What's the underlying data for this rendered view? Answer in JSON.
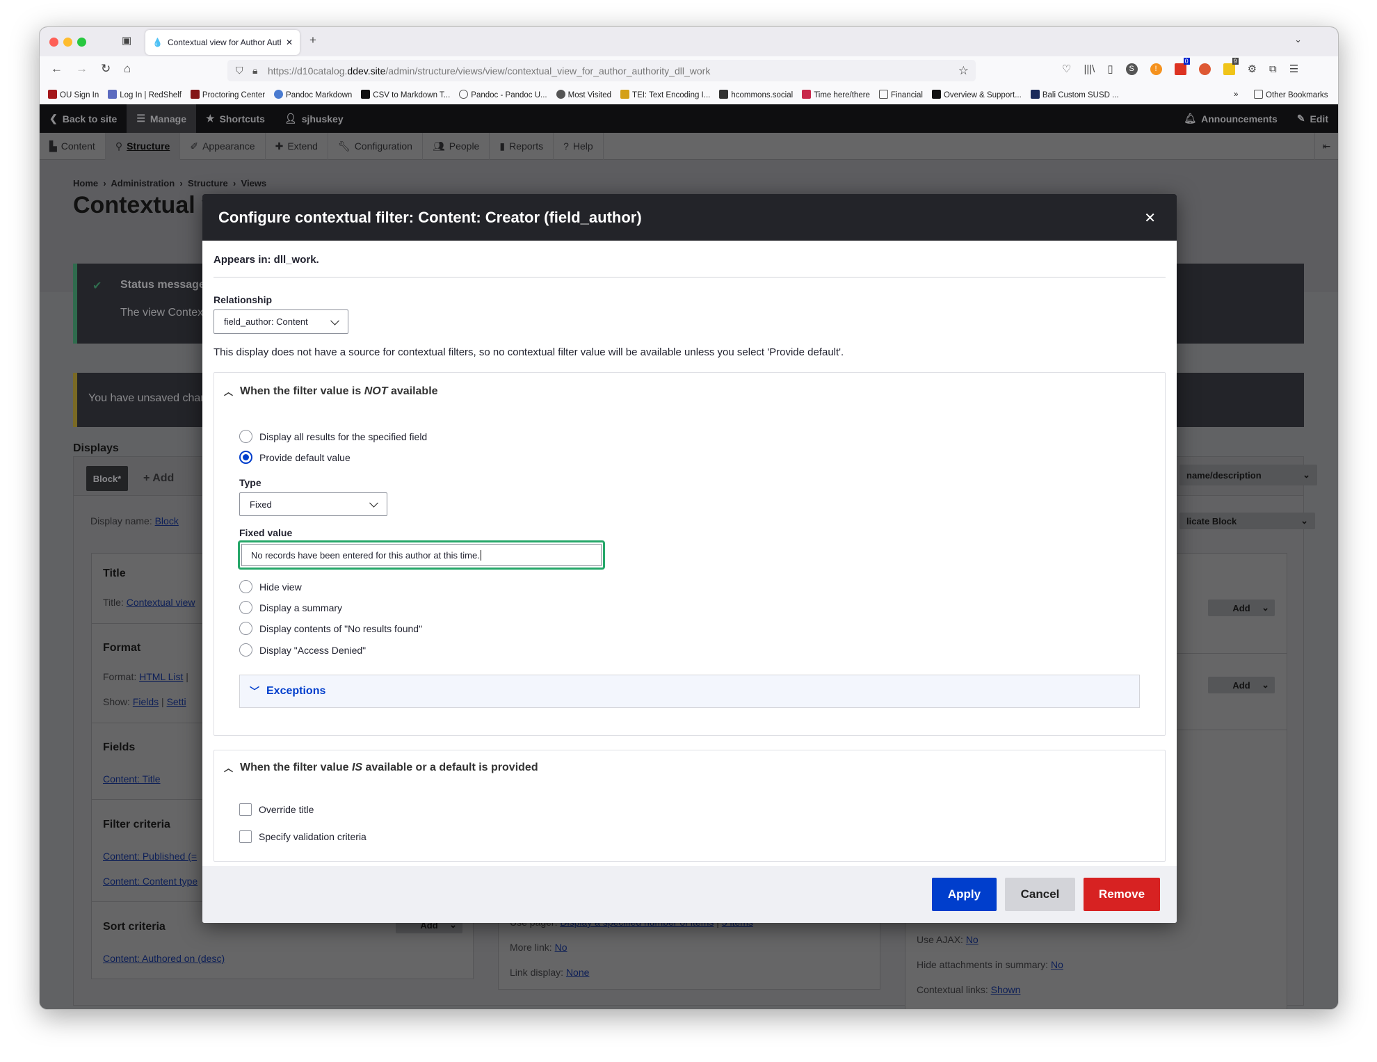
{
  "browser": {
    "tab_title": "Contextual view for Author Auth",
    "url_prefix": "https://d10catalog.",
    "url_domain": "ddev.site",
    "url_path": "/admin/structure/views/view/contextual_view_for_author_authority_dll_work",
    "bookmarks": [
      {
        "label": "OU Sign In",
        "color": "#a4161a"
      },
      {
        "label": "Log In | RedShelf",
        "color": "#5c6bc0"
      },
      {
        "label": "Proctoring Center",
        "color": "#841617"
      },
      {
        "label": "Pandoc Markdown",
        "color": "#4a7bd0"
      },
      {
        "label": "CSV to Markdown T...",
        "color": "#111111"
      },
      {
        "label": "Pandoc - Pandoc U...",
        "color": "#555555"
      },
      {
        "label": "Most Visited",
        "color": "#555555"
      },
      {
        "label": "TEI: Text Encoding I...",
        "color": "#d4a017"
      },
      {
        "label": "hcommons.social",
        "color": "#333333"
      },
      {
        "label": "Time here/there",
        "color": "#c8284a"
      },
      {
        "label": "Financial",
        "color": "#ffffff"
      },
      {
        "label": "Overview & Support...",
        "color": "#111111"
      },
      {
        "label": "Bali Custom SUSD ...",
        "color": "#1a2a5a"
      }
    ],
    "other_bookmarks": "Other Bookmarks",
    "badge_1": "0",
    "badge_2": "9"
  },
  "toolbar": {
    "back": "Back to site",
    "manage": "Manage",
    "shortcuts": "Shortcuts",
    "user": "sjhuskey",
    "announcements": "Announcements",
    "edit": "Edit",
    "menu": [
      "Content",
      "Structure",
      "Appearance",
      "Extend",
      "Configuration",
      "People",
      "Reports",
      "Help"
    ]
  },
  "background": {
    "breadcrumb": [
      "Home",
      "Administration",
      "Structure",
      "Views"
    ],
    "title": "Contextual view for Author Authority",
    "status_title": "Status message",
    "status_text": "The view Contextual",
    "unsaved": "You have unsaved changes.",
    "displays": "Displays",
    "block_tab": "Block*",
    "add": "+ Add",
    "edit_name": "name/description",
    "duplicate": "licate Block",
    "display_name_label": "Display name:",
    "display_name": "Block",
    "sections": {
      "title": "Title",
      "title_label": "Title:",
      "title_value": "Contextual view",
      "format": "Format",
      "format_label": "Format:",
      "format_value": "HTML List",
      "show_label": "Show:",
      "show_value": "Fields",
      "settings": "Setti",
      "fields": "Fields",
      "field_1": "Content: Title",
      "filter": "Filter criteria",
      "filter_1": "Content: Published (=",
      "filter_2": "Content: Content type",
      "sort": "Sort criteria",
      "sort_1": "Content: Authored on (desc)",
      "add_btn": "Add"
    },
    "middle": {
      "pager_label": "Use pager:",
      "pager_value": "Display a specified number of items",
      "pager_count": "5 items",
      "more_label": "More link:",
      "more_value": "No",
      "link_label": "Link display:",
      "link_value": "None"
    },
    "right": {
      "ajax_label": "Use AJAX:",
      "ajax_value": "No",
      "hide_label": "Hide attachments in summary:",
      "hide_value": "No",
      "ctx_label": "Contextual links:",
      "ctx_value": "Shown"
    }
  },
  "modal": {
    "title": "Configure contextual filter: Content: Creator (field_author)",
    "appears_in": "Appears in: dll_work.",
    "relationship_label": "Relationship",
    "relationship_value": "field_author: Content",
    "description": "This display does not have a source for contextual filters, so no contextual filter value will be available unless you select 'Provide default'.",
    "not_available": {
      "legend_pre": "When the filter value is ",
      "legend_em": "NOT",
      "legend_post": " available",
      "options": [
        "Display all results for the specified field",
        "Provide default value"
      ],
      "selected": "Provide default value",
      "type_label": "Type",
      "type_value": "Fixed",
      "fixed_label": "Fixed value",
      "fixed_value": "No records have been entered for this author at this time.",
      "more_options": [
        "Hide view",
        "Display a summary",
        "Display contents of \"No results found\"",
        "Display \"Access Denied\""
      ],
      "exceptions": "Exceptions"
    },
    "available": {
      "legend_pre": "When the filter value ",
      "legend_em": "IS",
      "legend_post": " available or a default is provided",
      "checkboxes": [
        "Override title",
        "Specify validation criteria"
      ]
    },
    "buttons": {
      "apply": "Apply",
      "cancel": "Cancel",
      "remove": "Remove"
    },
    "colors": {
      "primary": "#003ecc",
      "danger": "#d72222",
      "focus": "#26a769"
    }
  }
}
